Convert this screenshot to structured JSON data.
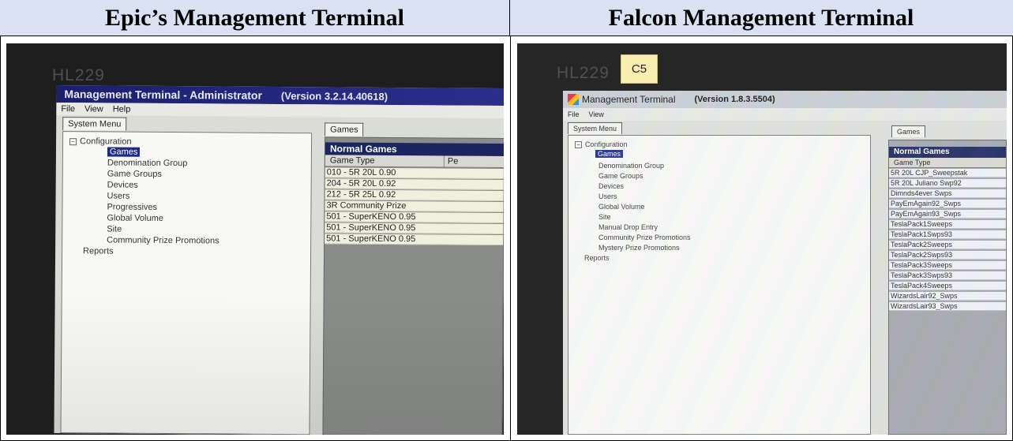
{
  "headers": {
    "left": "Epic’s Management Terminal",
    "right": "Falcon Management Terminal"
  },
  "left_screen": {
    "monitor_label": "HL229",
    "title": "Management Terminal - Administrator",
    "version": "(Version 3.2.14.40618)",
    "menu": [
      "File",
      "View",
      "Help"
    ],
    "system_tab": "System Menu",
    "games_tab": "Games",
    "tree": {
      "configuration": "Configuration",
      "items": [
        "Games",
        "Denomination Group",
        "Game Groups",
        "Devices",
        "Users",
        "Progressives",
        "Global Volume",
        "Site",
        "Community Prize Promotions"
      ],
      "reports": "Reports"
    },
    "grid_title": "Normal Games",
    "col_game_type": "Game Type",
    "col_second": "Pe",
    "games": [
      "010 - 5R 20L 0.90",
      "204 - 5R 20L 0.92",
      "212 - 5R 25L 0.92",
      "3R Community Prize",
      "501 - SuperKENO 0.95",
      "501 - SuperKENO 0.95",
      "501 - SuperKENO 0.95"
    ]
  },
  "right_screen": {
    "monitor_label": "HL229",
    "sticky_note": "C5",
    "title": "Management Terminal",
    "version": "(Version 1.8.3.5504)",
    "menu": [
      "File",
      "View"
    ],
    "system_tab": "System Menu",
    "games_tab": "Games",
    "tree": {
      "configuration": "Configuration",
      "items": [
        "Games",
        "Denomination Group",
        "Game Groups",
        "Devices",
        "Users",
        "Global Volume",
        "Site",
        "Manual Drop Entry",
        "Community Prize Promotions",
        "Mystery Prize Promotions"
      ],
      "reports": "Reports"
    },
    "grid_title": "Normal Games",
    "col_game_type": "Game Type",
    "games": [
      "5R 20L CJP_Sweepstak",
      "5R 20L Juliano Swp92",
      "Dimnds4ever Swps",
      "PayEmAgain92_Swps",
      "PayEmAgain93_Swps",
      "TeslaPack1Sweeps",
      "TeslaPack1Swps93",
      "TeslaPack2Sweeps",
      "TeslaPack2Swps93",
      "TeslaPack3Sweeps",
      "TeslaPack3Swps93",
      "TeslaPack4Sweeps",
      "WizardsLair92_Swps",
      "WizardsLair93_Swps"
    ]
  },
  "colors": {
    "header_band": "#d9e1f2",
    "left_titlebar": "#1c1f6e",
    "selection": "#1c2a8c",
    "grid_title": "#1b2660"
  }
}
